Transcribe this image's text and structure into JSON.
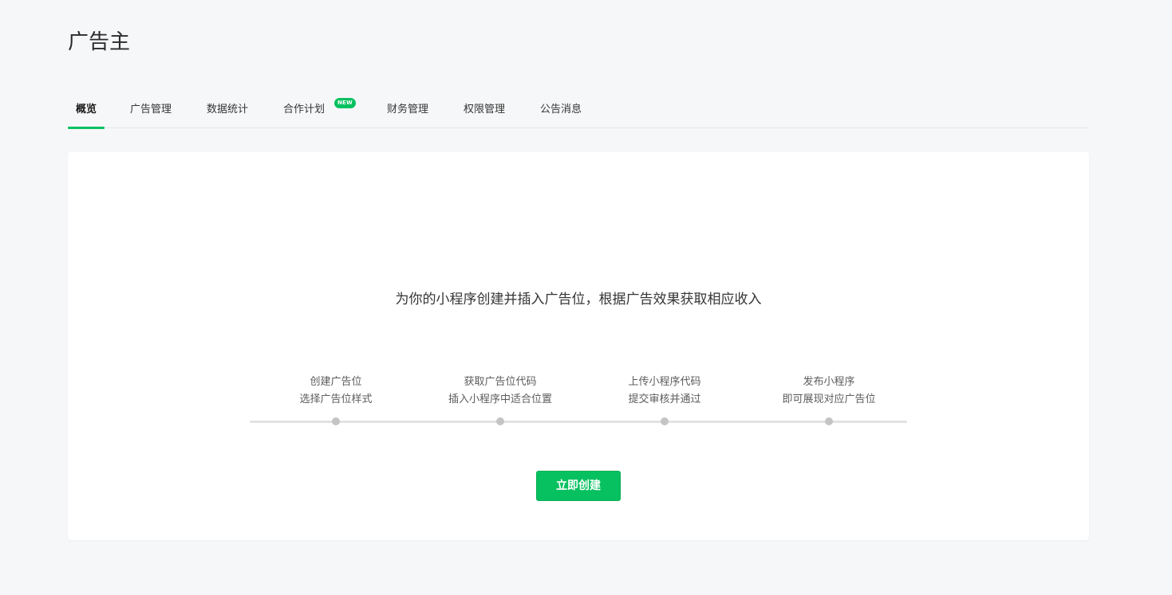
{
  "header": {
    "title": "广告主"
  },
  "tabs": [
    {
      "label": "概览"
    },
    {
      "label": "广告管理"
    },
    {
      "label": "数据统计"
    },
    {
      "label": "合作计划",
      "badge": "NEW"
    },
    {
      "label": "财务管理"
    },
    {
      "label": "权限管理"
    },
    {
      "label": "公告消息"
    }
  ],
  "main": {
    "headline": "为你的小程序创建并插入广告位，根据广告效果获取相应收入",
    "steps": [
      {
        "line1": "创建广告位",
        "line2": "选择广告位样式"
      },
      {
        "line1": "获取广告位代码",
        "line2": "插入小程序中适合位置"
      },
      {
        "line1": "上传小程序代码",
        "line2": "提交审核并通过"
      },
      {
        "line1": "发布小程序",
        "line2": "即可展现对应广告位"
      }
    ],
    "create_button": "立即创建"
  },
  "colors": {
    "accent": "#07c160",
    "background": "#f6f7f9",
    "card": "#ffffff",
    "step_dot": "#c4c4c4"
  }
}
